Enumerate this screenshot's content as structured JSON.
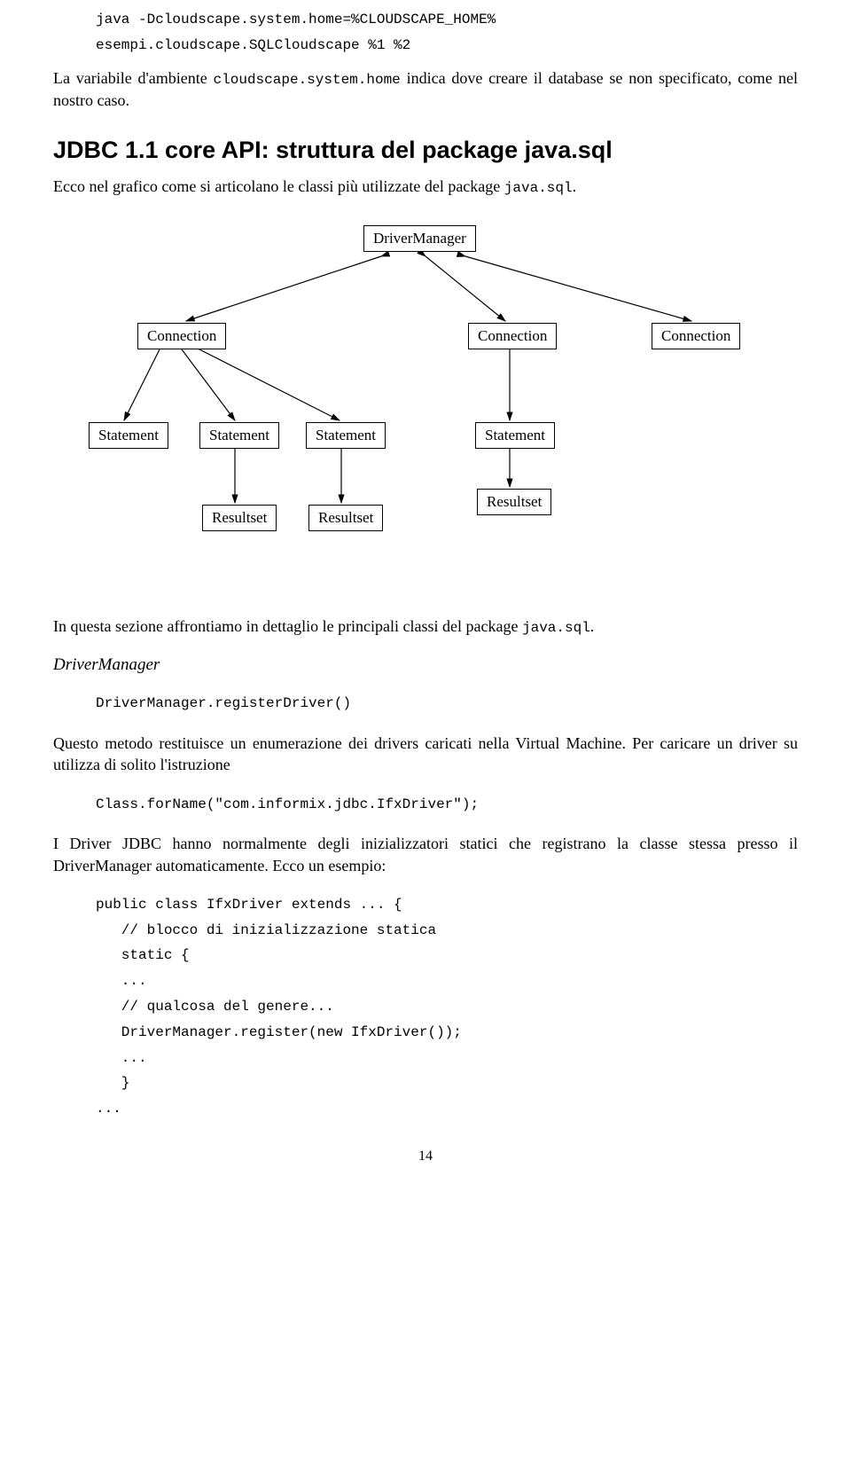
{
  "intro": {
    "code_lines": "java -Dcloudscape.system.home=%CLOUDSCAPE_HOME%\nesempi.cloudscape.SQLCloudscape %1 %2",
    "para1_pre": "La variabile d'ambiente ",
    "para1_code": "cloudscape.system.home",
    "para1_post": " indica dove creare il database se non specificato, come nel nostro caso."
  },
  "heading": "JDBC 1.1 core API: struttura del package java.sql",
  "heading_para_pre": "Ecco nel grafico come si articolano le classi più utilizzate del package ",
  "heading_para_code": "java.sql",
  "heading_para_post": ".",
  "diagram": {
    "driver_manager": "DriverManager",
    "connection": "Connection",
    "statement": "Statement",
    "resultset": "Resultset"
  },
  "after_diagram": {
    "para_pre": "In questa sezione affrontiamo in dettaglio le principali classi del package ",
    "para_code": "java.sql",
    "para_post": "."
  },
  "drivermanager_section": {
    "title": "DriverManager",
    "code1": "DriverManager.registerDriver()",
    "para1": "Questo metodo restituisce un enumerazione dei drivers caricati nella Virtual Machine. Per caricare un driver su utilizza di solito l'istruzione",
    "code2": "Class.forName(\"com.informix.jdbc.IfxDriver\");",
    "para2": "I Driver JDBC hanno normalmente degli inizializzatori statici che registrano la classe stessa presso il DriverManager automaticamente. Ecco un esempio:",
    "code3": "public class IfxDriver extends ... {\n   // blocco di inizializzazione statica\n   static {\n   ...\n   // qualcosa del genere...\n   DriverManager.register(new IfxDriver());\n   ...\n   }\n..."
  },
  "page_number": "14"
}
